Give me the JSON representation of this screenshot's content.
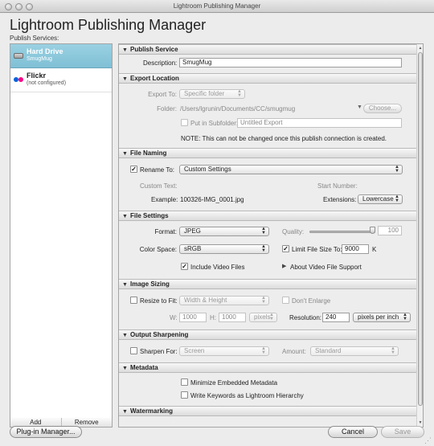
{
  "window": {
    "title": "Lightroom Publishing Manager",
    "heading": "Lightroom Publishing Manager",
    "services_label": "Publish Services:"
  },
  "services": [
    {
      "name": "Hard Drive",
      "sub": "SmugMug",
      "selected": true
    },
    {
      "name": "Flickr",
      "sub": "(not configured)",
      "selected": false
    }
  ],
  "list_buttons": {
    "add": "Add",
    "remove": "Remove"
  },
  "sections": {
    "publish_service": {
      "title": "Publish Service",
      "description_label": "Description:",
      "description_value": "SmugMug"
    },
    "export_location": {
      "title": "Export Location",
      "export_to_label": "Export To:",
      "export_to_value": "Specific folder",
      "folder_label": "Folder:",
      "folder_value": "/Users/lgrunin/Documents/CC/smugmug",
      "choose_button": "Choose...",
      "subfolder_label": "Put in Subfolder:",
      "subfolder_value": "Untitled Export",
      "note": "NOTE: This can not be changed once this publish connection is created."
    },
    "file_naming": {
      "title": "File Naming",
      "rename_label": "Rename To:",
      "rename_value": "Custom Settings",
      "custom_text_label": "Custom Text:",
      "start_number_label": "Start Number:",
      "example_label": "Example:",
      "example_value": "100326-IMG_0001.jpg",
      "extensions_label": "Extensions:",
      "extensions_value": "Lowercase"
    },
    "file_settings": {
      "title": "File Settings",
      "format_label": "Format:",
      "format_value": "JPEG",
      "quality_label": "Quality:",
      "quality_value": "100",
      "color_space_label": "Color Space:",
      "color_space_value": "sRGB",
      "limit_size_label": "Limit File Size To:",
      "limit_size_value": "9000",
      "limit_size_unit": "K",
      "include_video_label": "Include Video Files",
      "about_video_label": "About Video File Support"
    },
    "image_sizing": {
      "title": "Image Sizing",
      "resize_label": "Resize to Fit:",
      "resize_value": "Width & Height",
      "dont_enlarge_label": "Don't Enlarge",
      "w_label": "W:",
      "w_value": "1000",
      "h_label": "H:",
      "h_value": "1000",
      "units_value": "pixels",
      "resolution_label": "Resolution:",
      "resolution_value": "240",
      "resolution_unit": "pixels per inch"
    },
    "output_sharpening": {
      "title": "Output Sharpening",
      "sharpen_label": "Sharpen For:",
      "sharpen_value": "Screen",
      "amount_label": "Amount:",
      "amount_value": "Standard"
    },
    "metadata": {
      "title": "Metadata",
      "minimize_label": "Minimize Embedded Metadata",
      "keywords_label": "Write Keywords as Lightroom Hierarchy"
    },
    "watermarking": {
      "title": "Watermarking"
    }
  },
  "bottom": {
    "plugin_manager": "Plug-in Manager...",
    "cancel": "Cancel",
    "save": "Save"
  },
  "icons": {
    "expanded_triangle": "▼",
    "collapsed_triangle": "▶",
    "check": "✓",
    "popup_arrows": "▲▼"
  },
  "colors": {
    "selection": "#8cc8db",
    "flickr_blue": "#0063dc",
    "flickr_pink": "#ff0084"
  },
  "quality_fraction": 1.0
}
